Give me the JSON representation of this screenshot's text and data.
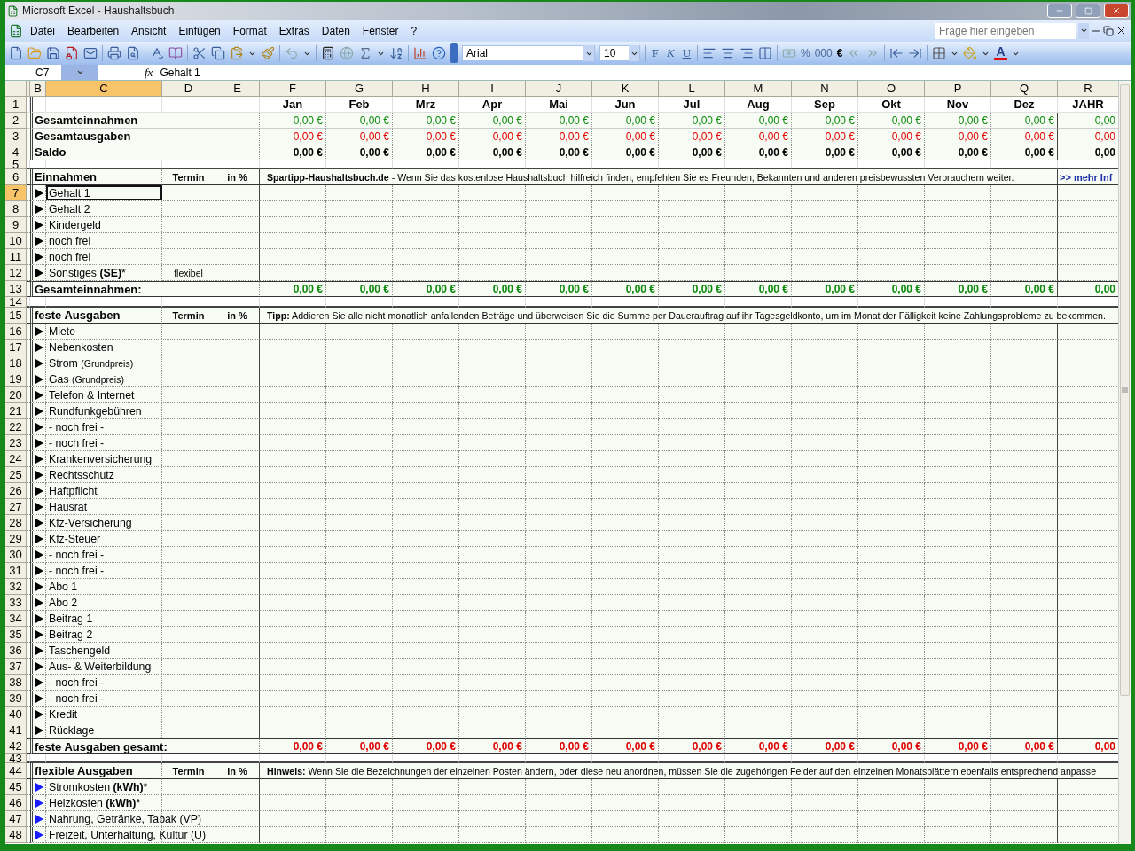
{
  "window": {
    "title": "Microsoft Excel - Haushaltsbuch"
  },
  "menu": {
    "items": [
      "Datei",
      "Bearbeiten",
      "Ansicht",
      "Einfügen",
      "Format",
      "Extras",
      "Daten",
      "Fenster",
      "?"
    ],
    "help_placeholder": "Frage hier eingeben"
  },
  "toolbar": {
    "font": "Arial",
    "size": "10",
    "style_buttons": [
      "F",
      "K",
      "U"
    ],
    "number_buttons": [
      "%",
      "000",
      "€"
    ],
    "font_color_button": "A"
  },
  "formula_bar": {
    "cell": "C7",
    "function_label": "fx",
    "value": "Gehalt 1"
  },
  "sheet": {
    "columns": [
      {
        "label": "B",
        "selected": false
      },
      {
        "label": "C",
        "selected": true
      },
      {
        "label": "D",
        "selected": false
      },
      {
        "label": "E",
        "selected": false
      },
      {
        "label": "F",
        "selected": false
      },
      {
        "label": "G",
        "selected": false
      },
      {
        "label": "H",
        "selected": false
      },
      {
        "label": "I",
        "selected": false
      },
      {
        "label": "J",
        "selected": false
      },
      {
        "label": "K",
        "selected": false
      },
      {
        "label": "L",
        "selected": false
      },
      {
        "label": "M",
        "selected": false
      },
      {
        "label": "N",
        "selected": false
      },
      {
        "label": "O",
        "selected": false
      },
      {
        "label": "P",
        "selected": false
      },
      {
        "label": "Q",
        "selected": false
      },
      {
        "label": "R",
        "selected": false
      }
    ],
    "rows": [
      {
        "number": "1",
        "kind": "months",
        "selected": false,
        "values": [
          "Jan",
          "Feb",
          "Mrz",
          "Apr",
          "Mai",
          "Jun",
          "Jul",
          "Aug",
          "Sep",
          "Okt",
          "Nov",
          "Dez",
          "JAHR"
        ]
      },
      {
        "number": "2",
        "kind": "summary",
        "selected": false,
        "label": "Gesamteinnahmen",
        "color": "#0d8a0d",
        "values": [
          "0,00 €",
          "0,00 €",
          "0,00 €",
          "0,00 €",
          "0,00 €",
          "0,00 €",
          "0,00 €",
          "0,00 €",
          "0,00 €",
          "0,00 €",
          "0,00 €",
          "0,00 €",
          "0,00"
        ]
      },
      {
        "number": "3",
        "kind": "summary",
        "selected": false,
        "label": "Gesamtausgaben",
        "color": "#e00000",
        "values": [
          "0,00 €",
          "0,00 €",
          "0,00 €",
          "0,00 €",
          "0,00 €",
          "0,00 €",
          "0,00 €",
          "0,00 €",
          "0,00 €",
          "0,00 €",
          "0,00 €",
          "0,00 €",
          "0,00"
        ]
      },
      {
        "number": "4",
        "kind": "summary",
        "selected": false,
        "label": "Saldo",
        "color": "#000000",
        "values": [
          "0,00 €",
          "0,00 €",
          "0,00 €",
          "0,00 €",
          "0,00 €",
          "0,00 €",
          "0,00 €",
          "0,00 €",
          "0,00 €",
          "0,00 €",
          "0,00 €",
          "0,00 €",
          "0,00"
        ]
      },
      {
        "number": "5",
        "kind": "spacer",
        "selected": false
      },
      {
        "number": "6",
        "kind": "section",
        "selected": false,
        "label": "Einnahmen",
        "termin": "Termin",
        "share": "in %",
        "note": "**Spartipp-Haushaltsbuch.de** - Wenn Sie das kostenlose Haushaltsbuch hilfreich finden, empfehlen Sie es Freunden, Bekannten und anderen preisbewussten Verbrauchern weiter.",
        "link": ">> mehr Inf"
      },
      {
        "number": "7",
        "kind": "item",
        "selected": true,
        "label": "Gehalt 1",
        "color": "#000000"
      },
      {
        "number": "8",
        "kind": "item",
        "selected": false,
        "label": "Gehalt 2",
        "color": "#000000"
      },
      {
        "number": "9",
        "kind": "item",
        "selected": false,
        "label": "Kindergeld",
        "color": "#000000"
      },
      {
        "number": "10",
        "kind": "item",
        "selected": false,
        "label": "noch frei",
        "color": "#000000"
      },
      {
        "number": "11",
        "kind": "item",
        "selected": false,
        "label": "noch frei",
        "color": "#000000"
      },
      {
        "number": "12",
        "kind": "item",
        "selected": false,
        "label": "Sonstiges **(SE)***",
        "termin": "flexibel",
        "color": "#000000"
      },
      {
        "number": "13",
        "kind": "total",
        "selected": false,
        "label": "Gesamteinnahmen:",
        "color": "#0d8a0d",
        "values": [
          "0,00 €",
          "0,00 €",
          "0,00 €",
          "0,00 €",
          "0,00 €",
          "0,00 €",
          "0,00 €",
          "0,00 €",
          "0,00 €",
          "0,00 €",
          "0,00 €",
          "0,00 €",
          "0,00"
        ]
      },
      {
        "number": "14",
        "kind": "spacer",
        "selected": false
      },
      {
        "number": "15",
        "kind": "section",
        "selected": false,
        "label": "feste Ausgaben",
        "termin": "Termin",
        "share": "in %",
        "note": "**Tipp:** Addieren Sie alle nicht monatlich anfallenden Beträge und überweisen Sie die Summe per Dauerauftrag auf ihr Tagesgeldkonto, um im Monat der Fälligkeit keine Zahlungsprobleme zu bekommen."
      },
      {
        "number": "16",
        "kind": "item",
        "selected": false,
        "label": "Miete",
        "color": "#000000"
      },
      {
        "number": "17",
        "kind": "item",
        "selected": false,
        "label": "Nebenkosten",
        "color": "#000000"
      },
      {
        "number": "18",
        "kind": "item",
        "selected": false,
        "label": "Strom",
        "note": "(Grundpreis)",
        "color": "#000000"
      },
      {
        "number": "19",
        "kind": "item",
        "selected": false,
        "label": "Gas",
        "note": "(Grundpreis)",
        "color": "#000000"
      },
      {
        "number": "20",
        "kind": "item",
        "selected": false,
        "label": "Telefon & Internet",
        "color": "#000000"
      },
      {
        "number": "21",
        "kind": "item",
        "selected": false,
        "label": "Rundfunkgebühren",
        "color": "#000000"
      },
      {
        "number": "22",
        "kind": "item",
        "selected": false,
        "label": "- noch frei -",
        "color": "#000000"
      },
      {
        "number": "23",
        "kind": "item",
        "selected": false,
        "label": "- noch frei -",
        "color": "#000000"
      },
      {
        "number": "24",
        "kind": "item",
        "selected": false,
        "label": "Krankenversicherung",
        "color": "#000000"
      },
      {
        "number": "25",
        "kind": "item",
        "selected": false,
        "label": "Rechtsschutz",
        "color": "#000000"
      },
      {
        "number": "26",
        "kind": "item",
        "selected": false,
        "label": "Haftpflicht",
        "color": "#000000"
      },
      {
        "number": "27",
        "kind": "item",
        "selected": false,
        "label": "Hausrat",
        "color": "#000000"
      },
      {
        "number": "28",
        "kind": "item",
        "selected": false,
        "label": "Kfz-Versicherung",
        "color": "#000000"
      },
      {
        "number": "29",
        "kind": "item",
        "selected": false,
        "label": "Kfz-Steuer",
        "color": "#000000"
      },
      {
        "number": "30",
        "kind": "item",
        "selected": false,
        "label": "- noch frei -",
        "color": "#000000"
      },
      {
        "number": "31",
        "kind": "item",
        "selected": false,
        "label": "- noch frei -",
        "color": "#000000"
      },
      {
        "number": "32",
        "kind": "item",
        "selected": false,
        "label": "Abo 1",
        "color": "#000000"
      },
      {
        "number": "33",
        "kind": "item",
        "selected": false,
        "label": "Abo 2",
        "color": "#000000"
      },
      {
        "number": "34",
        "kind": "item",
        "selected": false,
        "label": "Beitrag 1",
        "color": "#000000"
      },
      {
        "number": "35",
        "kind": "item",
        "selected": false,
        "label": "Beitrag 2",
        "color": "#000000"
      },
      {
        "number": "36",
        "kind": "item",
        "selected": false,
        "label": "Taschengeld",
        "color": "#000000"
      },
      {
        "number": "37",
        "kind": "item",
        "selected": false,
        "label": "Aus- & Weiterbildung",
        "color": "#000000"
      },
      {
        "number": "38",
        "kind": "item",
        "selected": false,
        "label": "- noch frei -",
        "color": "#000000"
      },
      {
        "number": "39",
        "kind": "item",
        "selected": false,
        "label": "- noch frei -",
        "color": "#000000"
      },
      {
        "number": "40",
        "kind": "item",
        "selected": false,
        "label": "Kredit",
        "color": "#000000"
      },
      {
        "number": "41",
        "kind": "item",
        "selected": false,
        "label": "Rücklage",
        "color": "#000000"
      },
      {
        "number": "42",
        "kind": "total",
        "selected": false,
        "label": "feste Ausgaben gesamt:",
        "color": "#e00000",
        "values": [
          "0,00 €",
          "0,00 €",
          "0,00 €",
          "0,00 €",
          "0,00 €",
          "0,00 €",
          "0,00 €",
          "0,00 €",
          "0,00 €",
          "0,00 €",
          "0,00 €",
          "0,00 €",
          "0,00"
        ]
      },
      {
        "number": "43",
        "kind": "spacer",
        "selected": false
      },
      {
        "number": "44",
        "kind": "section",
        "selected": false,
        "label": "flexible Ausgaben",
        "termin": "Termin",
        "share": "in %",
        "note": "**Hinweis:** Wenn Sie die Bezeichnungen der einzelnen Posten ändern, oder diese neu anordnen, müssen Sie die zugehörigen Felder auf den einzelnen Monatsblättern ebenfalls entsprechend anpasse"
      },
      {
        "number": "45",
        "kind": "item",
        "selected": false,
        "label": "Stromkosten **(kWh)***",
        "color": "#1a1aff"
      },
      {
        "number": "46",
        "kind": "item",
        "selected": false,
        "label": "Heizkosten **(kWh)***",
        "color": "#1a1aff"
      },
      {
        "number": "47",
        "kind": "item",
        "selected": false,
        "label": "Nahrung, Getränke, Tabak (VP)",
        "color": "#1a1aff"
      },
      {
        "number": "48",
        "kind": "item",
        "selected": false,
        "label": "Freizeit, Unterhaltung, Kultur (U)",
        "color": "#1a1aff"
      }
    ]
  }
}
